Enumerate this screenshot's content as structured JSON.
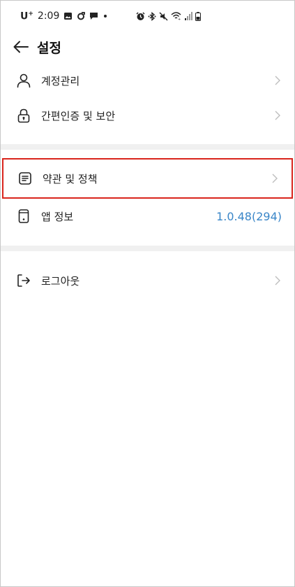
{
  "status_bar": {
    "carrier": "U",
    "carrier_sup": "+",
    "time": "2:09",
    "left_icons": [
      "image-icon",
      "sync-icon",
      "chat-icon",
      "dot-icon"
    ],
    "right_icons": [
      "alarm-icon",
      "bluetooth-icon",
      "mute-icon",
      "wifi-icon",
      "signal-icon",
      "battery-icon"
    ]
  },
  "header": {
    "title": "설정",
    "back_icon": "arrow-left-icon"
  },
  "menu": {
    "account": {
      "label": "계정관리",
      "icon": "person-icon"
    },
    "auth": {
      "label": "간편인증 및 보안",
      "icon": "lock-icon"
    },
    "terms": {
      "label": "약관 및 정책",
      "icon": "document-icon"
    },
    "app_info": {
      "label": "앱 정보",
      "icon": "phone-icon",
      "value": "1.0.48(294)"
    },
    "logout": {
      "label": "로그아웃",
      "icon": "logout-icon"
    }
  },
  "colors": {
    "accent_value": "#3a86c8",
    "highlight_border": "#d9251c",
    "divider": "#f0f0f0"
  }
}
